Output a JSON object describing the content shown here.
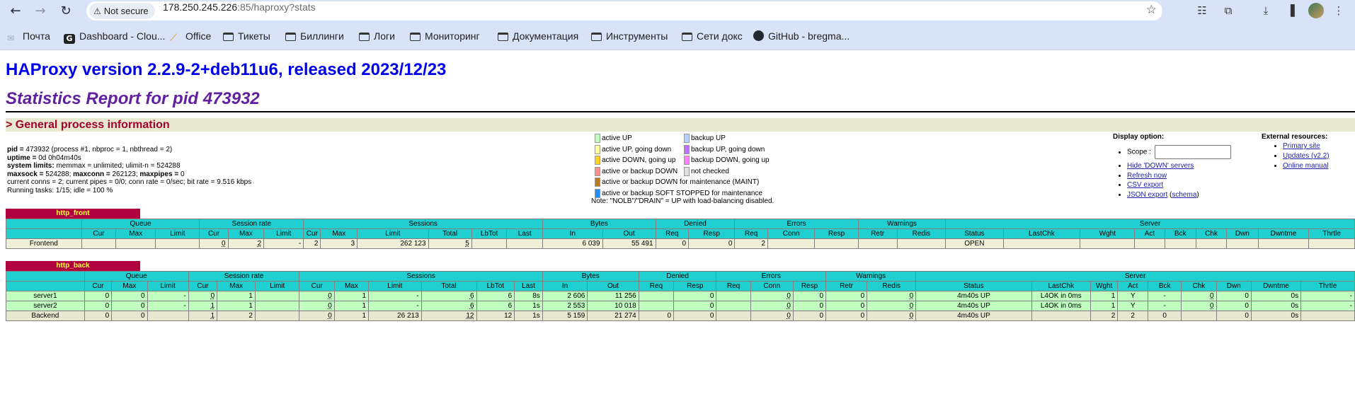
{
  "browser": {
    "security_label": "Not secure",
    "url_host": "178.250.245.226",
    "url_rest": ":85/haproxy?stats",
    "bookmarks": [
      {
        "label": "Почта",
        "icon": "gmail-icon"
      },
      {
        "label": "Dashboard - Clou...",
        "icon": "g-logo-icon"
      },
      {
        "label": "Office",
        "icon": "office-icon"
      },
      {
        "label": "Тикеты",
        "icon": "folder-icon"
      },
      {
        "label": "Биллинги",
        "icon": "folder-icon"
      },
      {
        "label": "Логи",
        "icon": "folder-icon"
      },
      {
        "label": "Мониторинг",
        "icon": "folder-icon"
      },
      {
        "label": "Документация",
        "icon": "folder-icon"
      },
      {
        "label": "Инструменты",
        "icon": "folder-icon"
      },
      {
        "label": "Сети докс",
        "icon": "folder-icon"
      },
      {
        "label": "GitHub - bregma...",
        "icon": "github-icon"
      }
    ]
  },
  "page": {
    "title": "HAProxy version 2.2.9-2+deb11u6, released 2023/12/23",
    "subtitle": "Statistics Report for pid 473932",
    "section_title": "> General process information"
  },
  "process_info": {
    "pid_label": "pid = ",
    "pid_value": "473932 (process #1, nbproc = 1, nbthread = 2)",
    "uptime_label": "uptime = ",
    "uptime_value": "0d 0h04m40s",
    "limits_label": "system limits:",
    "limits_value": " memmax = unlimited; ulimit-n = 524288",
    "maxsock_label": "maxsock = ",
    "maxsock_value": "524288; ",
    "maxconn_label": "maxconn = ",
    "maxconn_value": "262123; ",
    "maxpipes_label": "maxpipes = ",
    "maxpipes_value": "0",
    "current": "current conns = 2; current pipes = 0/0; conn rate = 0/sec; bit rate = 9.516 kbps",
    "tasks": "Running tasks: 1/15; idle = 100 %"
  },
  "legend": {
    "left": [
      {
        "label": "active UP",
        "color": "#c0ffc0"
      },
      {
        "label": "active UP, going down",
        "color": "#ffffa0"
      },
      {
        "label": "active DOWN, going up",
        "color": "#ffd020"
      },
      {
        "label": "active or backup DOWN",
        "color": "#ff9090"
      },
      {
        "label": "active or backup DOWN for maintenance (MAINT)",
        "color": "#c07820"
      },
      {
        "label": "active or backup SOFT STOPPED for maintenance",
        "color": "#1e90ff"
      }
    ],
    "right": [
      {
        "label": "backup UP",
        "color": "#b0d0ff"
      },
      {
        "label": "backup UP, going down",
        "color": "#c070ff"
      },
      {
        "label": "backup DOWN, going up",
        "color": "#ff80ff"
      },
      {
        "label": "not checked",
        "color": "#e0e0e0"
      }
    ],
    "note": "Note: \"NOLB\"/\"DRAIN\" = UP with load-balancing disabled."
  },
  "display_options": {
    "title": "Display option:",
    "scope_label": "Scope :",
    "hide_down": "Hide 'DOWN' servers",
    "refresh": "Refresh now",
    "csv": "CSV export",
    "json": "JSON export",
    "schema_open": " (",
    "schema": "schema",
    "schema_close": ")"
  },
  "external_resources": {
    "title": "External resources:",
    "primary": "Primary site",
    "updates": "Updates (v2.2)",
    "manual": "Online manual"
  },
  "headers": {
    "groups_front": [
      "Queue",
      "Session rate",
      "Sessions",
      "Bytes",
      "Denied",
      "Errors",
      "Warnings",
      "Server"
    ],
    "groups_back": [
      "Queue",
      "Session rate",
      "Sessions",
      "Bytes",
      "Denied",
      "Errors",
      "Warnings",
      "Server"
    ],
    "cols": [
      "Cur",
      "Max",
      "Limit",
      "Cur",
      "Max",
      "Limit",
      "Cur",
      "Max",
      "Limit",
      "Total",
      "LbTot",
      "Last",
      "In",
      "Out",
      "Req",
      "Resp",
      "Req",
      "Conn",
      "Resp",
      "Retr",
      "Redis",
      "Status",
      "LastChk",
      "Wght",
      "Act",
      "Bck",
      "Chk",
      "Dwn",
      "Dwntme",
      "Thrtle"
    ]
  },
  "http_front": {
    "name": "http_front",
    "rows": [
      {
        "name": "Frontend",
        "cells": [
          "",
          "",
          "",
          "0",
          "2",
          "-",
          "2",
          "3",
          "262 123",
          "5",
          "",
          "",
          "6 039",
          "55 491",
          "0",
          "0",
          "2",
          "",
          "",
          "",
          "",
          "OPEN",
          "",
          "",
          "",
          "",
          "",
          "",
          "",
          ""
        ]
      }
    ]
  },
  "http_back": {
    "name": "http_back",
    "servers": [
      {
        "name": "server1",
        "cells": [
          "0",
          "0",
          "-",
          "0",
          "1",
          "",
          "0",
          "1",
          "-",
          "6",
          "6",
          "8s",
          "2 606",
          "11 256",
          "",
          "0",
          "",
          "0",
          "0",
          "0",
          "0",
          "4m40s UP",
          "L4OK in 0ms",
          "1",
          "Y",
          "-",
          "0",
          "0",
          "0s",
          "-"
        ]
      },
      {
        "name": "server2",
        "cells": [
          "0",
          "0",
          "-",
          "1",
          "1",
          "",
          "0",
          "1",
          "-",
          "6",
          "6",
          "1s",
          "2 553",
          "10 018",
          "",
          "0",
          "",
          "0",
          "0",
          "0",
          "0",
          "4m40s UP",
          "L4OK in 0ms",
          "1",
          "Y",
          "-",
          "0",
          "0",
          "0s",
          "-"
        ]
      }
    ],
    "backend": {
      "name": "Backend",
      "cells": [
        "0",
        "0",
        "",
        "1",
        "2",
        "",
        "0",
        "1",
        "26 213",
        "12",
        "12",
        "1s",
        "5 159",
        "21 274",
        "0",
        "0",
        "",
        "0",
        "0",
        "0",
        "0",
        "4m40s UP",
        "",
        "2",
        "2",
        "0",
        "",
        "0",
        "0s",
        ""
      ]
    }
  }
}
